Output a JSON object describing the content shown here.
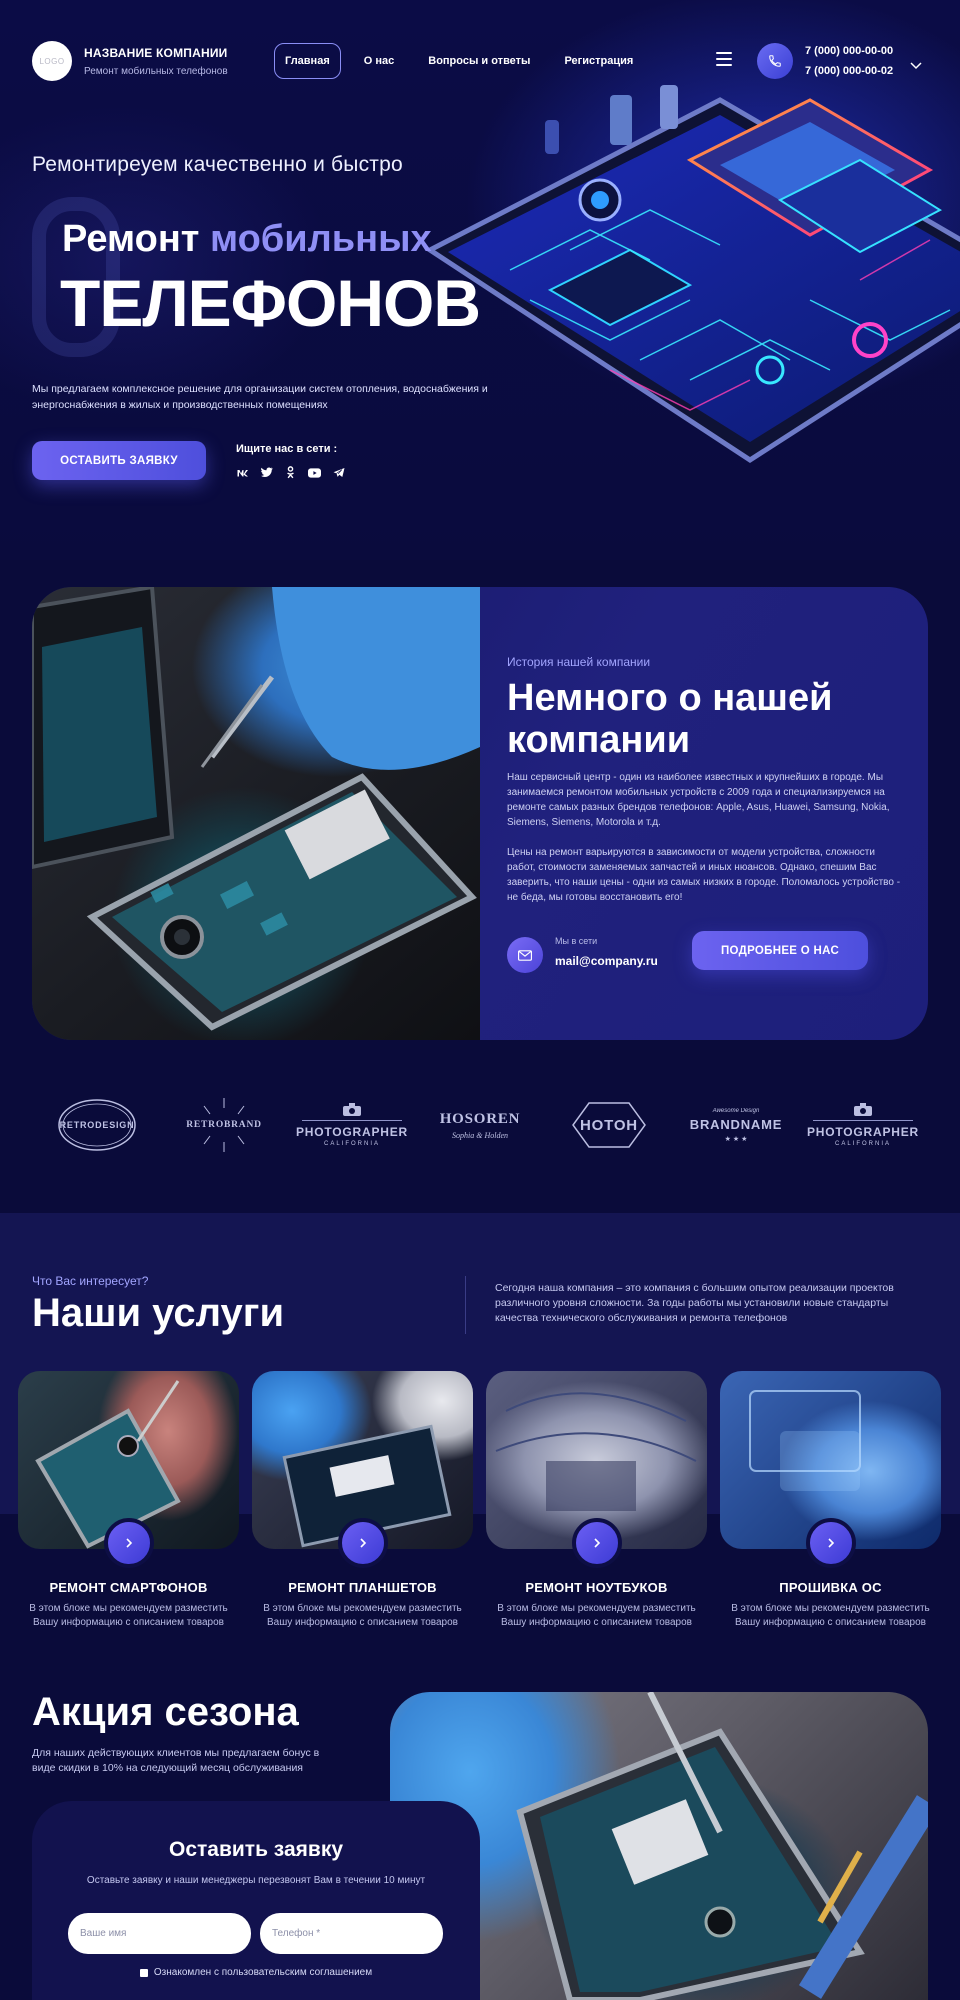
{
  "header": {
    "logo_text": "LOGO",
    "company_name": "НАЗВАНИЕ КОМПАНИИ",
    "company_sub": "Ремонт  мобильных телефонов",
    "nav": [
      {
        "label": "Главная",
        "active": true
      },
      {
        "label": "О нас",
        "active": false
      },
      {
        "label": "Вопросы и ответы",
        "active": false
      },
      {
        "label": "Регистрация",
        "active": false
      }
    ],
    "phones": [
      "7 (000) 000-00-00",
      "7 (000) 000-00-02"
    ]
  },
  "hero": {
    "tagline": "Ремонтиреуем качественно и быстро",
    "title_part1": "Ремонт ",
    "title_accent": "мобильных",
    "title_line2": "ТЕЛЕФОНОВ",
    "description": "Мы предлагаем комплексное решение для организации систем отопления, водоснабжения и энергоснабжения в жилых и производственных помещениях",
    "cta_label": "ОСТАВИТЬ ЗАЯВКУ",
    "social_title": "Ищите нас в сети :",
    "socials": [
      "vk-icon",
      "twitter-icon",
      "odnoklassniki-icon",
      "youtube-icon",
      "telegram-icon"
    ]
  },
  "about": {
    "label": "История нашей компании",
    "title": "Немного о нашей компании",
    "paragraph1": "Наш сервисный центр - один из наиболее известных и крупнейших в городе. Мы занимаемся ремонтом мобильных устройств с 2009 года и специализируемся на ремонте самых разных брендов телефонов: Apple, Asus, Huawei, Samsung, Nokia, Siemens, Siemens, Motorola и т.д.",
    "paragraph2": "Цены на ремонт варьируются в зависимости от модели устройства, сложности работ, стоимости заменяемых запчастей и иных нюансов. Однако, спешим Вас заверить, что наши цены - одни из самых низких в городе. Поломалось устройство - не беда, мы готовы восстановить его!",
    "mail_label": "Мы в сети",
    "mail_value": "mail@company.ru",
    "more_label": "ПОДРОБНЕЕ О НАС"
  },
  "brands": [
    {
      "name": "RETRODESIGN",
      "style": "badge"
    },
    {
      "name": "RETROBRAND",
      "style": "sunburst"
    },
    {
      "name": "PHOTOGRAPHER",
      "sub": "CALIFORNIA",
      "style": "camera"
    },
    {
      "name": "HOSOREN",
      "sub": "Sophia & Holden",
      "style": "script"
    },
    {
      "name": "HOTOH",
      "style": "hexagon"
    },
    {
      "name": "BRANDNAME",
      "sub": "Awesome Design",
      "style": "stars"
    },
    {
      "name": "PHOTOGRAPHER",
      "sub": "CALIFORNIA",
      "style": "camera"
    }
  ],
  "services": {
    "label": "Что Вас интересует?",
    "title": "Наши услуги",
    "description": "Сегодня наша компания – это компания с большим опытом реализации проектов различного уровня сложности. За годы работы мы установили новые стандарты качества технического обслуживания и ремонта телефонов",
    "cards": [
      {
        "title": "РЕМОНТ СМАРТФОНОВ",
        "text": "В этом блоке мы рекомендуем разместить Вашу информацию с описанием товаров"
      },
      {
        "title": "РЕМОНТ ПЛАНШЕТОВ",
        "text": "В этом блоке мы рекомендуем разместить Вашу информацию с описанием товаров"
      },
      {
        "title": "РЕМОНТ НОУТБУКОВ",
        "text": "В этом блоке мы рекомендуем разместить Вашу информацию с описанием товаров"
      },
      {
        "title": "ПРОШИВКА ОС",
        "text": "В этом блоке мы рекомендуем разместить Вашу информацию с описанием товаров"
      }
    ]
  },
  "promo": {
    "title": "Акция сезона",
    "description": "Для наших действующих клиентов мы предлагаем бонус в виде скидки в 10% на следующий месяц обслуживания",
    "form_title": "Оставить заявку",
    "form_sub": "Оставьте заявку и наши менеджеры перезвонят Вам в течении 10 минут",
    "name_placeholder": "Ваше имя",
    "phone_placeholder": "Телефон *",
    "agree_text": "Ознакомлен с пользовательским соглашением"
  },
  "colors": {
    "background": "#0a0b3a",
    "accent": "#6c63f0",
    "accent_text": "#8f8ff5",
    "label_text": "#a2a5ff"
  }
}
